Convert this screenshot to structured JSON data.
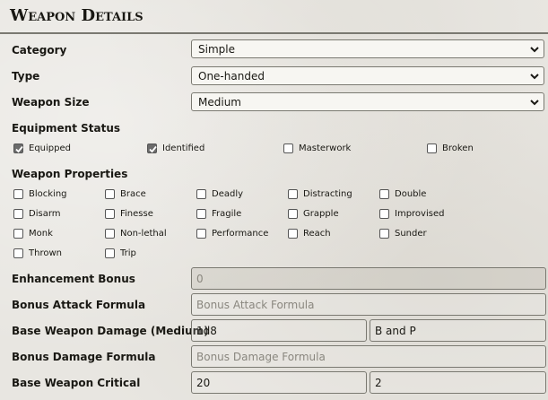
{
  "header": {
    "title": "Weapon Details"
  },
  "fields": {
    "category": {
      "label": "Category",
      "value": "Simple"
    },
    "type": {
      "label": "Type",
      "value": "One-handed"
    },
    "weapon_size": {
      "label": "Weapon Size",
      "value": "Medium"
    }
  },
  "equipment_status": {
    "label": "Equipment Status",
    "items": [
      {
        "label": "Equipped",
        "checked": true
      },
      {
        "label": "Identified",
        "checked": true
      },
      {
        "label": "Masterwork",
        "checked": false
      },
      {
        "label": "Broken",
        "checked": false
      }
    ]
  },
  "weapon_properties": {
    "label": "Weapon Properties",
    "items": [
      {
        "label": "Blocking",
        "checked": false
      },
      {
        "label": "Brace",
        "checked": false
      },
      {
        "label": "Deadly",
        "checked": false
      },
      {
        "label": "Distracting",
        "checked": false
      },
      {
        "label": "Double",
        "checked": false
      },
      {
        "label": "Disarm",
        "checked": false
      },
      {
        "label": "Finesse",
        "checked": false
      },
      {
        "label": "Fragile",
        "checked": false
      },
      {
        "label": "Grapple",
        "checked": false
      },
      {
        "label": "Improvised",
        "checked": false
      },
      {
        "label": "Monk",
        "checked": false
      },
      {
        "label": "Non-lethal",
        "checked": false
      },
      {
        "label": "Performance",
        "checked": false
      },
      {
        "label": "Reach",
        "checked": false
      },
      {
        "label": "Sunder",
        "checked": false
      },
      {
        "label": "Thrown",
        "checked": false
      },
      {
        "label": "Trip",
        "checked": false
      }
    ]
  },
  "enhancement_bonus": {
    "label": "Enhancement Bonus",
    "value": "0"
  },
  "bonus_attack_formula": {
    "label": "Bonus Attack Formula",
    "placeholder": "Bonus Attack Formula"
  },
  "base_weapon_damage": {
    "label": "Base Weapon Damage (Medium)",
    "dice": "1d8",
    "damage_type": "B and P"
  },
  "bonus_damage_formula": {
    "label": "Bonus Damage Formula",
    "placeholder": "Bonus Damage Formula"
  },
  "base_weapon_critical": {
    "label": "Base Weapon Critical",
    "range": "20",
    "multiplier": "2"
  }
}
